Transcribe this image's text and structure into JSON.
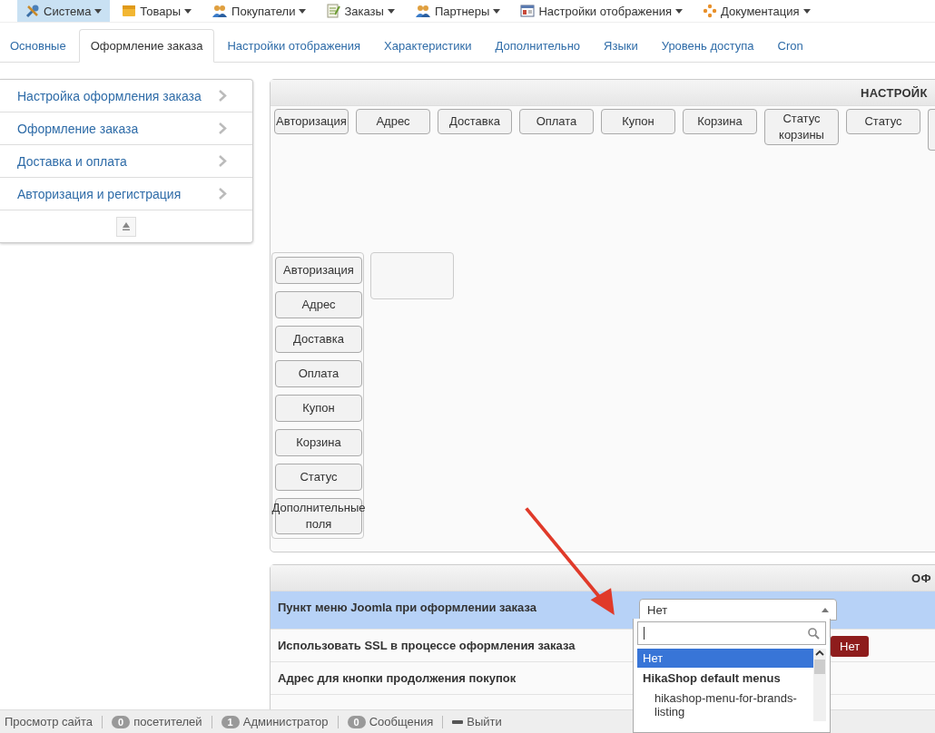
{
  "menu": [
    {
      "label": "Система",
      "selected": true
    },
    {
      "label": "Товары",
      "selected": false
    },
    {
      "label": "Покупатели",
      "selected": false
    },
    {
      "label": "Заказы",
      "selected": false
    },
    {
      "label": "Партнеры",
      "selected": false
    },
    {
      "label": "Настройки отображения",
      "selected": false
    },
    {
      "label": "Документация",
      "selected": false
    }
  ],
  "tabs": [
    {
      "label": "Основные",
      "selected": false
    },
    {
      "label": "Оформление заказа",
      "selected": true
    },
    {
      "label": "Настройки отображения",
      "selected": false
    },
    {
      "label": "Характеристики",
      "selected": false
    },
    {
      "label": "Дополнительно",
      "selected": false
    },
    {
      "label": "Языки",
      "selected": false
    },
    {
      "label": "Уровень доступа",
      "selected": false
    },
    {
      "label": "Cron",
      "selected": false
    }
  ],
  "sidebar": {
    "items": [
      "Настройка оформления заказа",
      "Оформление заказа",
      "Доставка и оплата",
      "Авторизация и регистрация"
    ]
  },
  "workflow_panel": {
    "title": "НАСТРОЙК",
    "steps": [
      "Авторизация",
      "Адрес",
      "Доставка",
      "Оплата",
      "Купон",
      "Корзина",
      "Статус корзины",
      "Статус"
    ],
    "available": [
      "Авторизация",
      "Адрес",
      "Доставка",
      "Оплата",
      "Купон",
      "Корзина",
      "Статус",
      "Дополнительные поля"
    ]
  },
  "checkout_panel": {
    "title": "ОФ",
    "rows": [
      {
        "label": "Пункт меню Joomla при оформлении заказа",
        "selected": true,
        "kind": "select",
        "value": "Нет"
      },
      {
        "label": "Использовать SSL в процессе оформления заказа",
        "selected": false,
        "kind": "toggle",
        "value": "Нет"
      },
      {
        "label": "Адрес для кнопки продолжения покупок",
        "selected": false,
        "kind": "text"
      }
    ]
  },
  "dropdown": {
    "options": [
      {
        "label": "Нет",
        "kind": "option",
        "selected": true
      },
      {
        "label": "HikaShop default menus",
        "kind": "group"
      },
      {
        "label": "hikashop-menu-for-brands-listing",
        "kind": "option",
        "selected": false
      }
    ]
  },
  "status_bar": [
    {
      "label": "Просмотр сайта",
      "kind": "link"
    },
    {
      "count": "0",
      "label": "посетителей",
      "kind": "counter"
    },
    {
      "count": "1",
      "label": "Администратор",
      "kind": "counter"
    },
    {
      "count": "0",
      "label": "Сообщения",
      "kind": "counter"
    },
    {
      "label": "Выйти",
      "kind": "logout"
    }
  ]
}
